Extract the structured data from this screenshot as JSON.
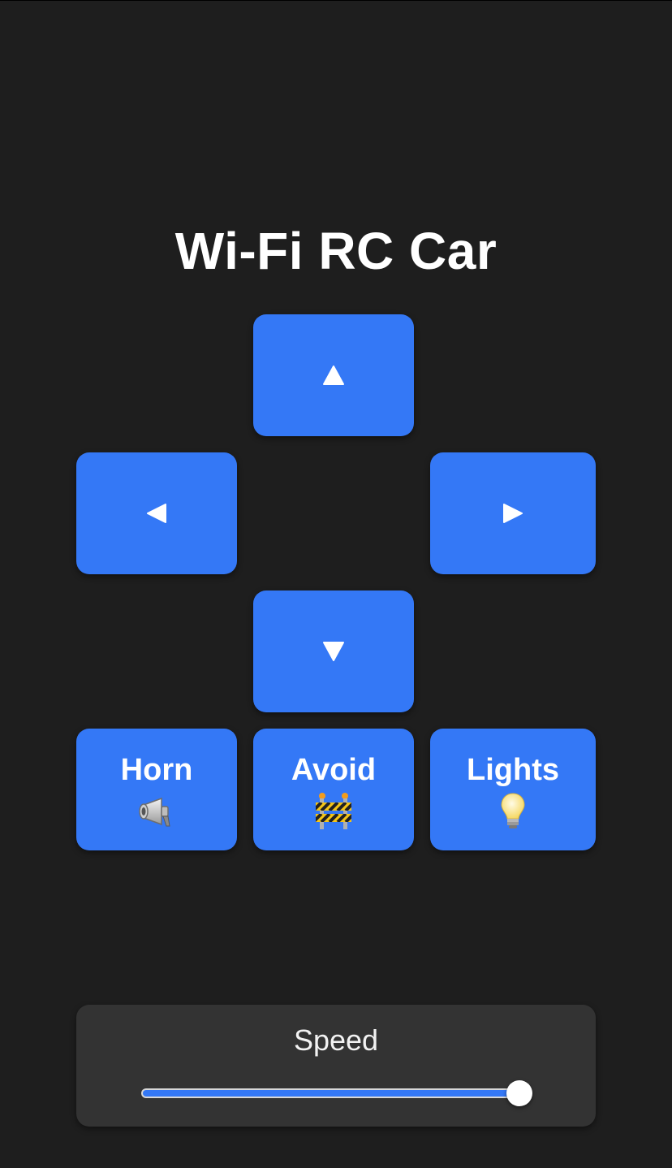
{
  "title": "Wi-Fi RC Car",
  "controls": {
    "up_icon": "triangle-up-icon",
    "left_icon": "triangle-left-icon",
    "right_icon": "triangle-right-icon",
    "down_icon": "triangle-down-icon"
  },
  "actions": {
    "horn_label": "Horn",
    "horn_icon": "megaphone-icon",
    "avoid_label": "Avoid",
    "avoid_icon": "construction-barrier-icon",
    "lights_label": "Lights",
    "lights_icon": "light-bulb-icon"
  },
  "speed": {
    "label": "Speed",
    "value_fraction": 1.0
  },
  "colors": {
    "background": "#1e1e1e",
    "accent": "#3478f6",
    "panel": "#333333"
  }
}
